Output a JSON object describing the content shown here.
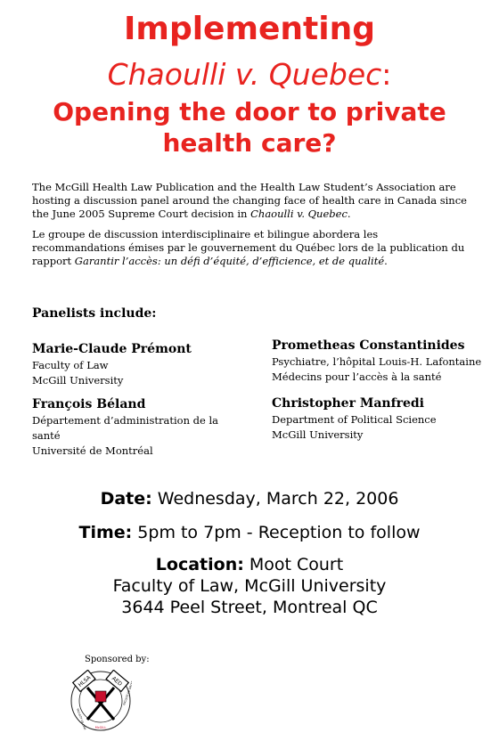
{
  "header": {
    "line1": "Implementing",
    "line2_case": "Chaoulli v. Quebec",
    "line2_colon": ":",
    "line3a": "Opening the door to private",
    "line3b": "health care?"
  },
  "intro_en": {
    "text": "The McGill Health Law Publication and the Health Law Student’s Association are hosting a discussion panel around the changing face of health care in Canada since the June 2005 Supreme Court decision in ",
    "case": "Chaoulli v. Quebec",
    "end": "."
  },
  "intro_fr": {
    "text": "Le groupe de discussion interdisciplinaire et bilingue abordera les recommandations émises par le gouvernement du Québec lors de la publication du rapport ",
    "report": "Garantir l’accès: un défi d’équité, d’efficience, et de qualité",
    "end": "."
  },
  "panelists_heading": "Panelists include:",
  "panelists": [
    {
      "name": "Marie-Claude Prémont",
      "line1": "Faculty of Law",
      "line2": "McGill University"
    },
    {
      "name": "François Béland",
      "line1": "Département d’administration de la santé",
      "line2": "Université de Montréal"
    },
    {
      "name": "Prometheas Constantinides",
      "line1": "Psychiatre, l’hôpital Louis-H. Lafontaine",
      "line2": "Médecins pour l’accès à la santé"
    },
    {
      "name": "Christopher Manfredi",
      "line1": "Department of Political Science",
      "line2": "McGill University"
    }
  ],
  "event": {
    "date_label": "Date:",
    "date": " Wednesday, March 22, 2006",
    "time_label": "Time:",
    "time": " 5pm to 7pm - Reception to follow",
    "location_label": "Location:",
    "location": " Moot Court",
    "address1": "Faculty of Law, McGill University",
    "address2": "3644 Peel Street, Montreal QC"
  },
  "sponsors": {
    "label": "Sponsored by:",
    "logo_left": "HLSA",
    "logo_right": "AED",
    "logo_ring_left": "FACULTY OF LAW",
    "logo_ring_bottom": "McGILL",
    "logo_ring_right": "FACULTÉ DE DROIT"
  },
  "colors": {
    "title_red": "#e8231f"
  }
}
